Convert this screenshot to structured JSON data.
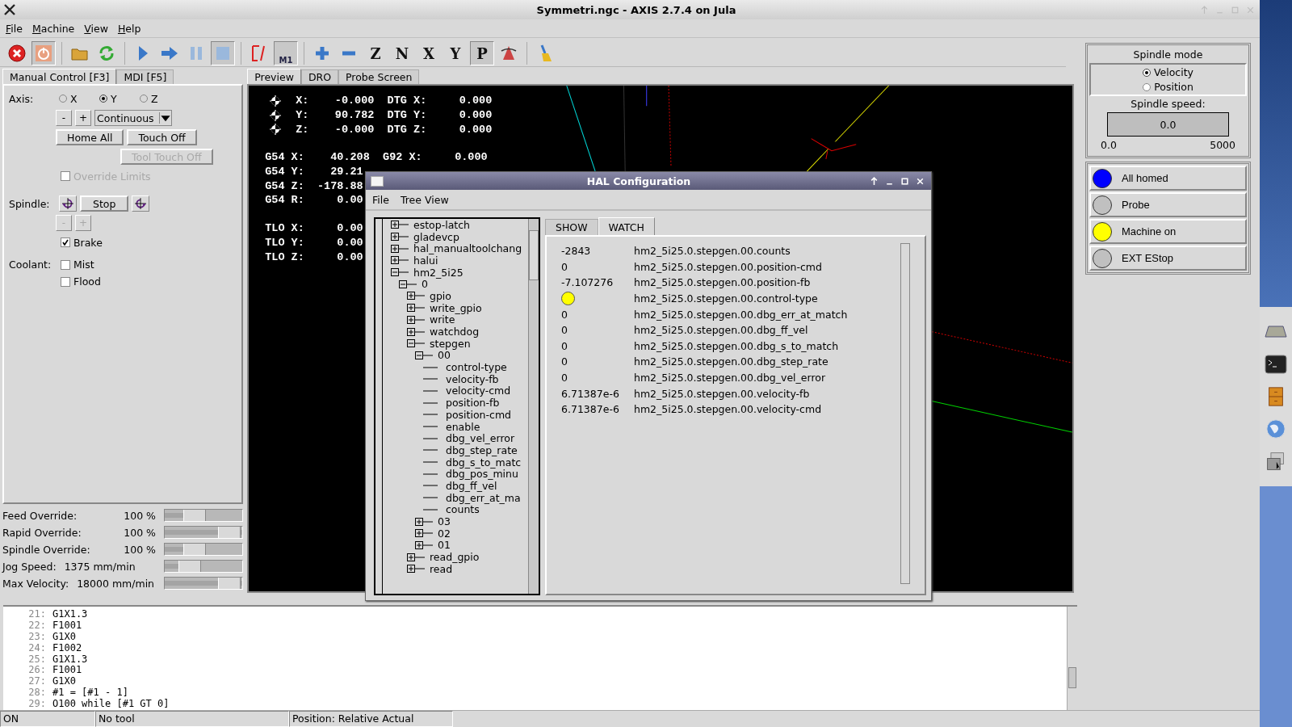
{
  "window": {
    "title": "Symmetri.ngc - AXIS 2.7.4 on Jula"
  },
  "menu": [
    "File",
    "Machine",
    "View",
    "Help"
  ],
  "toolbar": [
    {
      "kind": "estop",
      "pressed": false
    },
    {
      "kind": "power",
      "pressed": true
    },
    {
      "kind": "sep"
    },
    {
      "kind": "open",
      "pressed": false
    },
    {
      "kind": "reload",
      "pressed": false
    },
    {
      "kind": "sep"
    },
    {
      "kind": "run",
      "pressed": false
    },
    {
      "kind": "step",
      "pressed": false
    },
    {
      "kind": "pause",
      "pressed": false
    },
    {
      "kind": "stop",
      "pressed": true
    },
    {
      "kind": "sep"
    },
    {
      "kind": "skip",
      "pressed": false
    },
    {
      "kind": "optional-stop",
      "label": "M1",
      "pressed": true
    },
    {
      "kind": "sep"
    },
    {
      "kind": "zoom-in",
      "pressed": false
    },
    {
      "kind": "zoom-out",
      "pressed": false
    },
    {
      "kind": "view",
      "label": "Z",
      "pressed": false
    },
    {
      "kind": "view",
      "label": "N",
      "pressed": false
    },
    {
      "kind": "view",
      "label": "X",
      "pressed": false
    },
    {
      "kind": "view",
      "label": "Y",
      "pressed": false
    },
    {
      "kind": "view",
      "label": "P",
      "pressed": true
    },
    {
      "kind": "rotate",
      "pressed": false
    },
    {
      "kind": "sep"
    },
    {
      "kind": "clear",
      "pressed": false
    }
  ],
  "left_tabs": [
    {
      "label": "Manual Control [F3]",
      "selected": true
    },
    {
      "label": "MDI [F5]",
      "selected": false
    }
  ],
  "axis": {
    "label": "Axis:",
    "options": [
      {
        "label": "X",
        "selected": false
      },
      {
        "label": "Y",
        "selected": true
      },
      {
        "label": "Z",
        "selected": false
      }
    ]
  },
  "jog": {
    "minus": "-",
    "plus": "+",
    "mode": "Continuous"
  },
  "home_buttons": [
    {
      "label": "Home All",
      "disabled": false
    },
    {
      "label": "Touch Off",
      "disabled": false
    }
  ],
  "tool_touch_off": {
    "label": "Tool Touch Off",
    "disabled": true
  },
  "override_limits": {
    "label": "Override Limits",
    "checked": false,
    "disabled": true
  },
  "spindle": {
    "label": "Spindle:",
    "stop": "Stop",
    "minus": "-",
    "plus": "+",
    "disabled": true
  },
  "brake": {
    "label": "Brake",
    "checked": true
  },
  "coolant": {
    "label": "Coolant:",
    "options": [
      {
        "label": "Mist",
        "checked": false
      },
      {
        "label": "Flood",
        "checked": false
      }
    ]
  },
  "sliders": [
    {
      "label": "Feed Override:",
      "reading": "100 %",
      "level": 0.35
    },
    {
      "label": "Rapid Override:",
      "reading": "100 %",
      "level": 1
    },
    {
      "label": "Spindle Override:",
      "reading": "100 %",
      "level": 0.35
    },
    {
      "label": "Jog Speed:",
      "reading": "1375 mm/min",
      "level": 0.25
    },
    {
      "label": "Max Velocity:",
      "reading": "18000 mm/min",
      "level": 1
    }
  ],
  "preview_tabs": [
    {
      "label": "Preview",
      "selected": true
    },
    {
      "label": "DRO",
      "selected": false
    },
    {
      "label": "Probe Screen",
      "selected": false
    }
  ],
  "dro": [
    [
      {
        "kind": "axis",
        "text": "X:    -0.000  DTG X:     0.000"
      },
      {
        "kind": "axis",
        "text": "Y:    90.782  DTG Y:     0.000"
      },
      {
        "kind": "axis",
        "text": "Z:    -0.000  DTG Z:     0.000"
      }
    ],
    [
      {
        "kind": "offset",
        "text": "G54 X:    40.208  G92 X:     0.000"
      },
      {
        "kind": "offset",
        "text": "G54 Y:    29.21"
      },
      {
        "kind": "offset",
        "text": "G54 Z:  -178.88"
      },
      {
        "kind": "offset",
        "text": "G54 R:     0.00"
      }
    ],
    [
      {
        "kind": "offset",
        "text": "TLO X:     0.00"
      },
      {
        "kind": "offset",
        "text": "TLO Y:     0.00"
      },
      {
        "kind": "offset",
        "text": "TLO Z:     0.00"
      }
    ]
  ],
  "spindle_mode": {
    "title": "Spindle mode",
    "options": [
      {
        "label": "Velocity",
        "selected": true
      },
      {
        "label": "Position",
        "selected": false
      }
    ]
  },
  "spindle_speed": {
    "label": "Spindle speed:",
    "value": "0.0",
    "level": 0,
    "min": "0.0",
    "max": "5000"
  },
  "indicators": [
    {
      "label": "All homed",
      "color": "#0000ff"
    },
    {
      "label": "Probe",
      "color": "#c0c0c0"
    },
    {
      "label": "Machine on",
      "color": "#ffff00"
    },
    {
      "label": "EXT EStop",
      "color": "#c0c0c0"
    }
  ],
  "gcode": [
    {
      "number": "21:",
      "code": "G1X1.3"
    },
    {
      "number": "22:",
      "code": "F1001"
    },
    {
      "number": "23:",
      "code": "G1X0"
    },
    {
      "number": "24:",
      "code": "F1002"
    },
    {
      "number": "25:",
      "code": "G1X1.3"
    },
    {
      "number": "26:",
      "code": "F1001"
    },
    {
      "number": "27:",
      "code": "G1X0"
    },
    {
      "number": "28:",
      "code": "#1 = [#1 - 1]"
    },
    {
      "number": "29:",
      "code": "O100 while [#1 GT 0]"
    }
  ],
  "status_bar": [
    "ON",
    "No tool",
    "Position: Relative Actual"
  ],
  "hal": {
    "title": "HAL Configuration",
    "menu": [
      "File",
      "Tree View"
    ],
    "tree": [
      {
        "label": "estop-latch",
        "expanded": false
      },
      {
        "label": "gladevcp",
        "expanded": false
      },
      {
        "label": "hal_manualtoolchang",
        "expanded": false
      },
      {
        "label": "halui",
        "expanded": false
      },
      {
        "label": "hm2_5i25",
        "expanded": true,
        "children": [
          {
            "label": "0",
            "expanded": true,
            "children": [
              {
                "label": "gpio",
                "expanded": false
              },
              {
                "label": "write_gpio",
                "expanded": false
              },
              {
                "label": "write",
                "expanded": false
              },
              {
                "label": "watchdog",
                "expanded": false
              },
              {
                "label": "stepgen",
                "expanded": true,
                "children": [
                  {
                    "label": "00",
                    "expanded": true,
                    "children": [
                      {
                        "label": "control-type"
                      },
                      {
                        "label": "velocity-fb"
                      },
                      {
                        "label": "velocity-cmd"
                      },
                      {
                        "label": "position-fb"
                      },
                      {
                        "label": "position-cmd"
                      },
                      {
                        "label": "enable"
                      },
                      {
                        "label": "dbg_vel_error"
                      },
                      {
                        "label": "dbg_step_rate"
                      },
                      {
                        "label": "dbg_s_to_matc"
                      },
                      {
                        "label": "dbg_pos_minu"
                      },
                      {
                        "label": "dbg_ff_vel"
                      },
                      {
                        "label": "dbg_err_at_ma"
                      },
                      {
                        "label": "counts"
                      }
                    ]
                  },
                  {
                    "label": "03",
                    "expanded": false
                  },
                  {
                    "label": "02",
                    "expanded": false
                  },
                  {
                    "label": "01",
                    "expanded": false
                  }
                ]
              },
              {
                "label": "read_gpio",
                "expanded": false
              },
              {
                "label": "read",
                "expanded": false
              }
            ]
          }
        ]
      }
    ],
    "tabs": [
      {
        "label": "SHOW",
        "selected": false
      },
      {
        "label": "WATCH",
        "selected": true
      }
    ],
    "watch": [
      {
        "kind": "value",
        "value": "-2843",
        "name": "hm2_5i25.0.stepgen.00.counts"
      },
      {
        "kind": "value",
        "value": "0",
        "name": "hm2_5i25.0.stepgen.00.position-cmd"
      },
      {
        "kind": "value",
        "value": "-7.107276",
        "name": "hm2_5i25.0.stepgen.00.position-fb"
      },
      {
        "kind": "bit",
        "on": true,
        "name": "hm2_5i25.0.stepgen.00.control-type"
      },
      {
        "kind": "value",
        "value": "0",
        "name": "hm2_5i25.0.stepgen.00.dbg_err_at_match"
      },
      {
        "kind": "value",
        "value": "0",
        "name": "hm2_5i25.0.stepgen.00.dbg_ff_vel"
      },
      {
        "kind": "value",
        "value": "0",
        "name": "hm2_5i25.0.stepgen.00.dbg_s_to_match"
      },
      {
        "kind": "value",
        "value": "0",
        "name": "hm2_5i25.0.stepgen.00.dbg_step_rate"
      },
      {
        "kind": "value",
        "value": "0",
        "name": "hm2_5i25.0.stepgen.00.dbg_vel_error"
      },
      {
        "kind": "value",
        "value": "6.71387e-6",
        "name": "hm2_5i25.0.stepgen.00.velocity-fb"
      },
      {
        "kind": "value",
        "value": "6.71387e-6",
        "name": "hm2_5i25.0.stepgen.00.velocity-cmd"
      }
    ]
  }
}
